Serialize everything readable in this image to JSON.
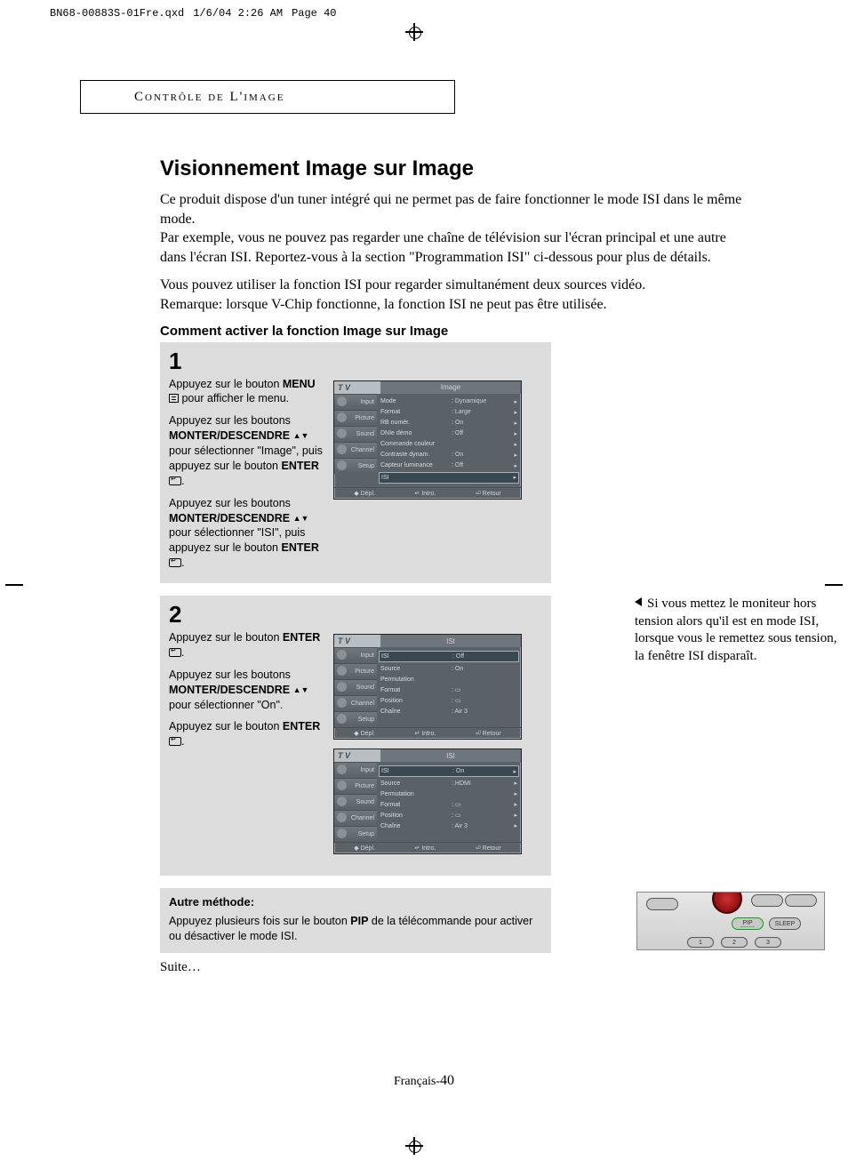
{
  "print_header": {
    "file": "BN68-00883S-01Fre.qxd",
    "date": "1/6/04 2:26 AM",
    "page_label": "Page 40"
  },
  "section_header": "Contrôle de L'image",
  "title": "Visionnement Image sur Image",
  "intro_para": "Ce produit dispose d'un tuner intégré qui ne permet pas de faire fonctionner le mode ISI dans le même mode.\nPar exemple, vous ne pouvez pas regarder une chaîne de télévision sur l'écran principal et une autre dans l'écran ISI. Reportez-vous à la section \"Programmation ISI\" ci-dessous pour plus de détails.",
  "intro_para2": "Vous pouvez utiliser la fonction ISI pour regarder simultanément deux sources vidéo.\nRemarque: lorsque V-Chip fonctionne, la fonction ISI ne peut pas être utilisée.",
  "subhead": "Comment activer la fonction Image sur Image",
  "step1": {
    "num": "1",
    "p1a": "Appuyez sur le bouton ",
    "p1b": "MENU",
    "p1c": " pour afficher le menu.",
    "p2a": "Appuyez sur les boutons ",
    "p2b": "MONTER/DESCENDRE",
    "p2c": " pour sélectionner \"Image\", puis appuyez sur le bouton ",
    "p2d": "ENTER",
    "p2e": ".",
    "p3a": "Appuyez sur les boutons ",
    "p3b": "MONTER/DESCENDRE",
    "p3c": " pour sélectionner \"ISI\", puis appuyez sur le bouton ",
    "p3d": "ENTER",
    "p3e": "."
  },
  "step2": {
    "num": "2",
    "p1a": "Appuyez sur le bouton ",
    "p1b": "ENTER",
    "p1c": ".",
    "p2a": "Appuyez sur les boutons ",
    "p2b": "MONTER/DESCENDRE",
    "p2c": " pour sélectionner \"On\".",
    "p3a": "Appuyez sur le bouton ",
    "p3b": "ENTER",
    "p3c": "."
  },
  "side_note": "Si vous mettez le moniteur hors tension alors qu'il est en mode ISI, lorsque vous le remettez sous tension, la fenêtre ISI disparaît.",
  "osd_common": {
    "tv": "T V",
    "tabs": [
      "Input",
      "Picture",
      "Sound",
      "Channel",
      "Setup"
    ],
    "foot": [
      "◆ Dépl.",
      "↵ Intro.",
      "⏎ Retour"
    ]
  },
  "osd1": {
    "title": "Image",
    "rows": [
      {
        "l": "Mode",
        "v": ": Dynamique",
        "a": "▸"
      },
      {
        "l": "Format",
        "v": ": Large",
        "a": "▸"
      },
      {
        "l": "RB numér.",
        "v": ": On",
        "a": "▸"
      },
      {
        "l": "DNIe démo",
        "v": ": Off",
        "a": "▸"
      },
      {
        "l": "Commande couleur",
        "v": "",
        "a": "▸"
      },
      {
        "l": "Contraste dynam.",
        "v": ": On",
        "a": "▸"
      },
      {
        "l": "Capteur luminance",
        "v": ": Off",
        "a": "▸"
      },
      {
        "l": "ISI",
        "v": "",
        "a": "▸",
        "hl": true
      }
    ]
  },
  "osd2": {
    "title": "ISI",
    "rows": [
      {
        "l": "ISI",
        "v": ": Off",
        "a": "",
        "hl": true
      },
      {
        "l": "Source",
        "v": ": On",
        "a": ""
      },
      {
        "l": "Permutation",
        "v": "",
        "a": ""
      },
      {
        "l": "Format",
        "v": ": ▭",
        "a": ""
      },
      {
        "l": "Position",
        "v": ": ▭",
        "a": ""
      },
      {
        "l": "Chaîne",
        "v": ": Air   3",
        "a": ""
      }
    ]
  },
  "osd3": {
    "title": "ISI",
    "rows": [
      {
        "l": "ISI",
        "v": ": On",
        "a": "▸",
        "hl": true
      },
      {
        "l": "Source",
        "v": ": HDMI",
        "a": "▸"
      },
      {
        "l": "Permutation",
        "v": "",
        "a": "▸"
      },
      {
        "l": "Format",
        "v": ": ▭",
        "a": "▸"
      },
      {
        "l": "Position",
        "v": ": ▭",
        "a": "▸"
      },
      {
        "l": "Chaîne",
        "v": ": Air   3",
        "a": "▸"
      }
    ]
  },
  "alt": {
    "title": "Autre méthode:",
    "body_a": "Appuyez plusieurs fois sur le bouton ",
    "body_b": "PIP",
    "body_c": " de la télécommande pour activer ou désactiver le mode ISI."
  },
  "remote": {
    "pip": "PIP",
    "sleep": "SLEEP",
    "n1": "1",
    "n2": "2",
    "n3": "3"
  },
  "suite": "Suite…",
  "page_label_a": "Français-",
  "page_label_b": "40"
}
